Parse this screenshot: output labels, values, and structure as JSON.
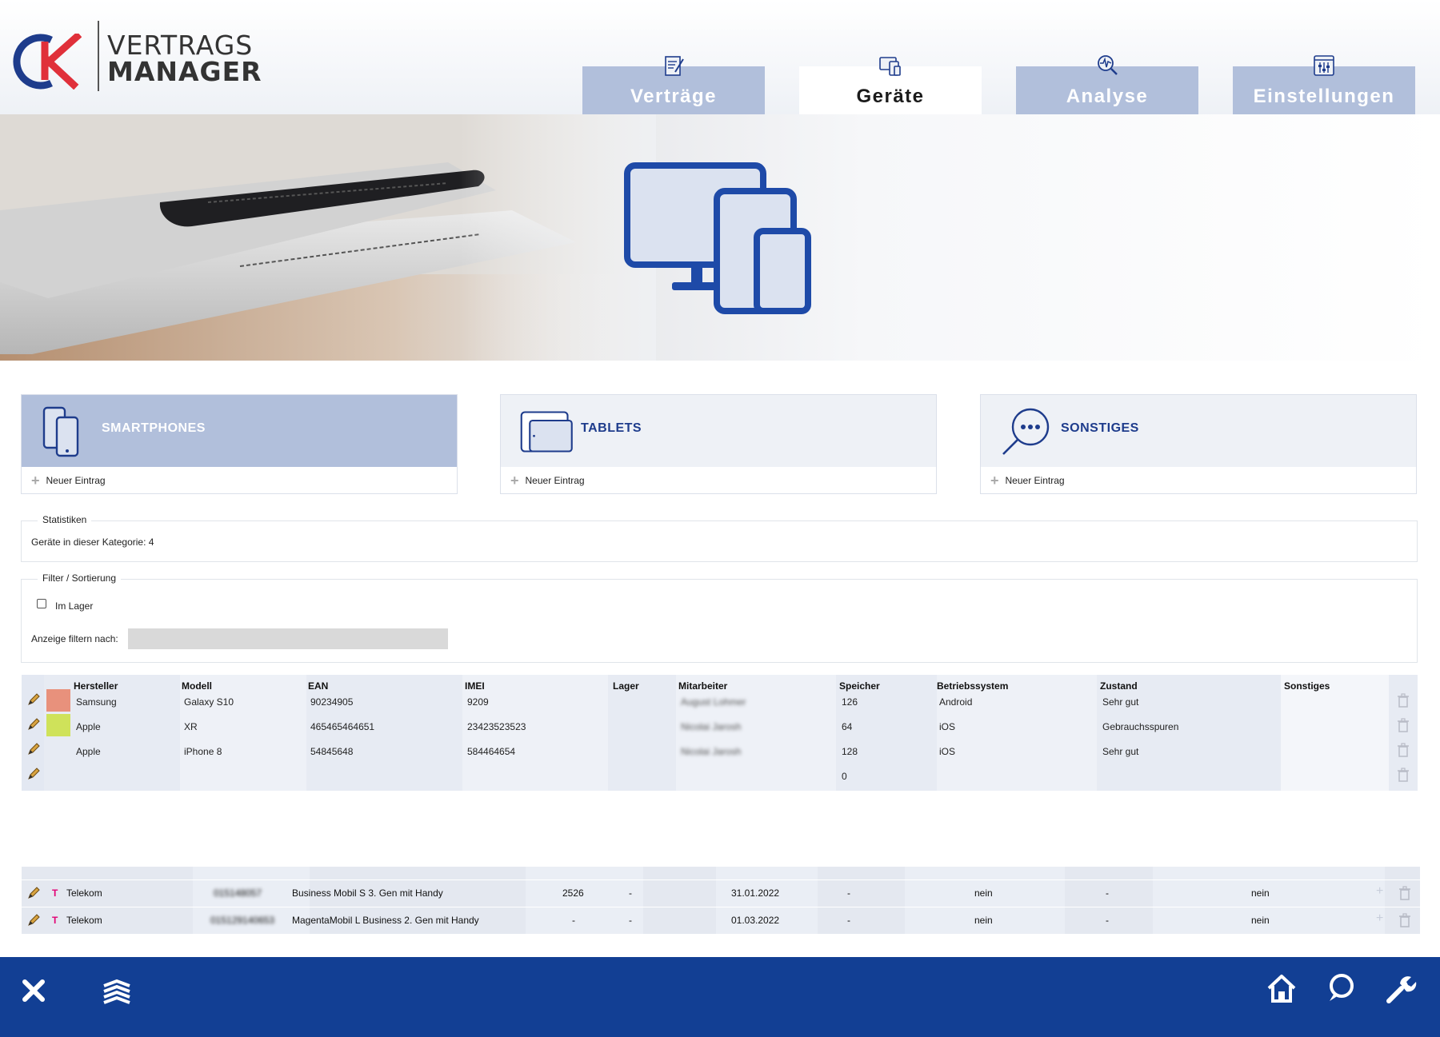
{
  "app": {
    "logo_line1": "VERTRAGS",
    "logo_line2": "MANAGER"
  },
  "nav": {
    "tabs": [
      {
        "label": "Verträge",
        "icon": "contract-icon",
        "active": false
      },
      {
        "label": "Geräte",
        "icon": "devices-icon",
        "active": true
      },
      {
        "label": "Analyse",
        "icon": "analysis-icon",
        "active": false
      },
      {
        "label": "Einstellungen",
        "icon": "settings-sliders-icon",
        "active": false
      }
    ]
  },
  "hero": {
    "icon": "devices-icon"
  },
  "categories": [
    {
      "title": "SMARTPHONES",
      "icon": "smartphones-icon",
      "new_label": "Neuer Eintrag",
      "active": true
    },
    {
      "title": "TABLETS",
      "icon": "tablet-icon",
      "new_label": "Neuer Eintrag",
      "active": false
    },
    {
      "title": "SONSTIGES",
      "icon": "chat-search-icon",
      "new_label": "Neuer Eintrag",
      "active": false
    }
  ],
  "stats": {
    "legend": "Statistiken",
    "text": "Geräte in dieser Kategorie: 4"
  },
  "filter": {
    "legend": "Filter / Sortierung",
    "checkbox_label": "Im Lager",
    "checkbox_checked": false,
    "filter_label": "Anzeige filtern nach:",
    "filter_value": ""
  },
  "device_table": {
    "headers": [
      "Hersteller",
      "Modell",
      "EAN",
      "IMEI",
      "Lager",
      "Mitarbeiter",
      "Speicher",
      "Betriebssystem",
      "Zustand",
      "Sonstiges"
    ],
    "rows": [
      {
        "color": "#e8917c",
        "hersteller": "Samsung",
        "modell": "Galaxy S10",
        "ean": "90234905",
        "imei": "9209",
        "lager": "",
        "mitarbeiter": "August Lohmer",
        "speicher": "126",
        "os": "Android",
        "zustand": "Sehr gut",
        "sonstiges": ""
      },
      {
        "color": "#cfe25a",
        "hersteller": "Apple",
        "modell": "XR",
        "ean": "465465464651",
        "imei": "23423523523",
        "lager": "",
        "mitarbeiter": "Nicolai Jarosh",
        "speicher": "64",
        "os": "iOS",
        "zustand": "Gebrauchsspuren",
        "sonstiges": ""
      },
      {
        "color": "",
        "hersteller": "Apple",
        "modell": "iPhone 8",
        "ean": "54845648",
        "imei": "584464654",
        "lager": "",
        "mitarbeiter": "Nicolai Jarosh",
        "speicher": "128",
        "os": "iOS",
        "zustand": "Sehr gut",
        "sonstiges": ""
      },
      {
        "color": "",
        "hersteller": "",
        "modell": "",
        "ean": "",
        "imei": "",
        "lager": "",
        "mitarbeiter": "",
        "speicher": "0",
        "os": "",
        "zustand": "",
        "sonstiges": ""
      }
    ]
  },
  "contract_table": {
    "rows": [
      {
        "provider": "Telekom",
        "number": "015148057",
        "tariff": "Business Mobil S 3. Gen mit Handy",
        "amount": "2526",
        "col5": "-",
        "date": "31.01.2022",
        "col7": "-",
        "col8": "nein",
        "col9": "-",
        "col10": "nein"
      },
      {
        "provider": "Telekom",
        "number": "015129140653",
        "tariff": "MagentaMobil L Business 2. Gen mit Handy",
        "amount": "-",
        "col5": "-",
        "date": "01.03.2022",
        "col7": "-",
        "col8": "nein",
        "col9": "-",
        "col10": "nein"
      }
    ]
  },
  "footer": {
    "left": [
      "close-icon",
      "layers-icon"
    ],
    "right": [
      "home-icon",
      "chat-icon",
      "wrench-icon"
    ]
  }
}
